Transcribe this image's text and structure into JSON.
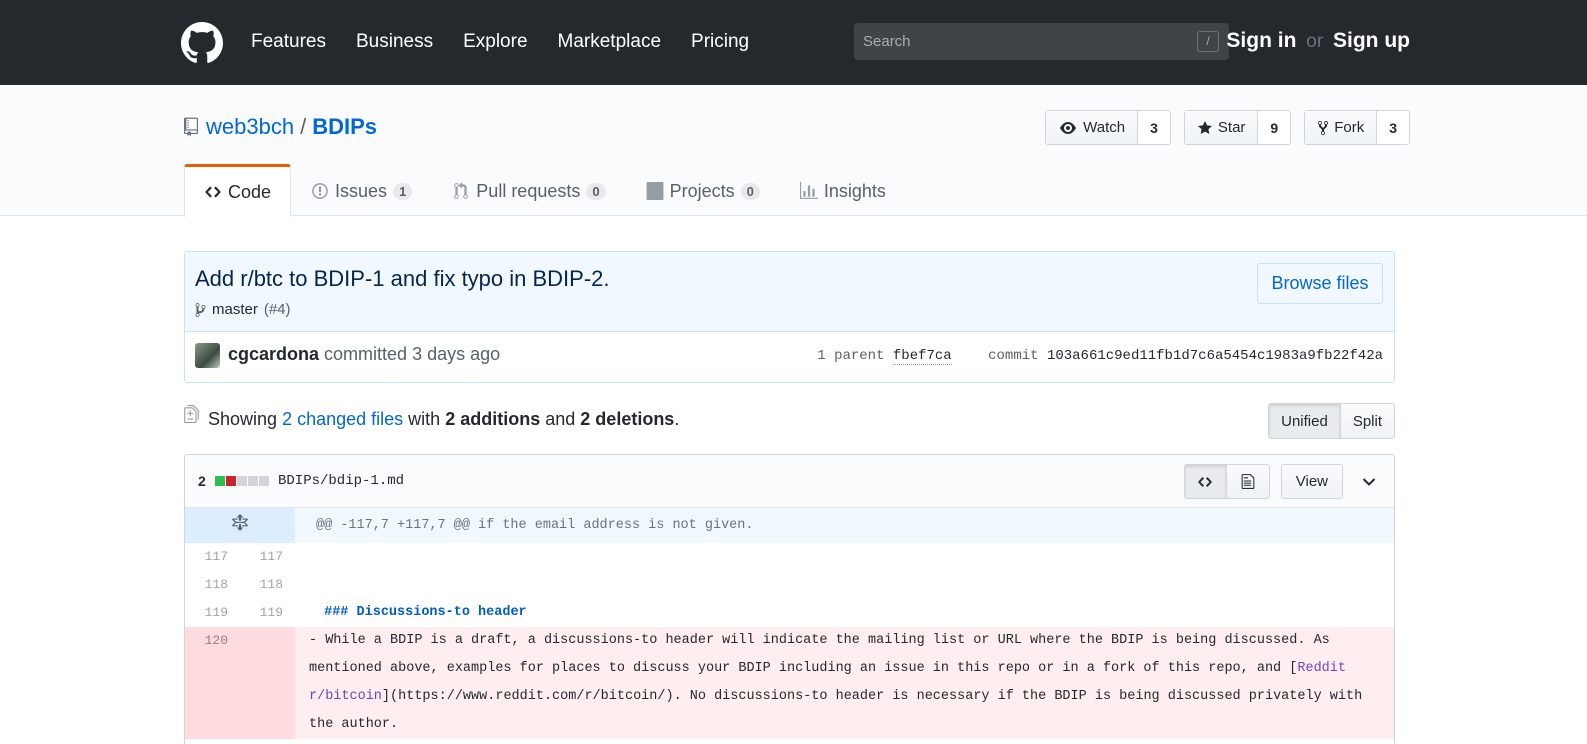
{
  "header": {
    "nav": [
      "Features",
      "Business",
      "Explore",
      "Marketplace",
      "Pricing"
    ],
    "search_placeholder": "Search",
    "search_shortcut": "/",
    "sign_in": "Sign in",
    "or": "or",
    "sign_up": "Sign up"
  },
  "repo": {
    "owner": "web3bch",
    "separator": "/",
    "name": "BDIPs",
    "watch_label": "Watch",
    "watch_count": "3",
    "star_label": "Star",
    "star_count": "9",
    "fork_label": "Fork",
    "fork_count": "3"
  },
  "tabs": {
    "code": "Code",
    "issues": "Issues",
    "issues_count": "1",
    "pulls": "Pull requests",
    "pulls_count": "0",
    "projects": "Projects",
    "projects_count": "0",
    "insights": "Insights"
  },
  "commit": {
    "title": "Add r/btc to BDIP-1 and fix typo in BDIP-2.",
    "branch": "master",
    "pr_ref": "(#4)",
    "browse_label": "Browse files",
    "author": "cgcardona",
    "action": "committed 3 days ago",
    "parent_label": "1 parent",
    "parent_sha": "fbef7ca",
    "commit_label": "commit",
    "sha": "103a661c9ed11fb1d7c6a5454c1983a9fb22f42a"
  },
  "toc": {
    "showing": "Showing",
    "changed_files": "2 changed files",
    "with": "with",
    "additions": "2 additions",
    "and": "and",
    "deletions": "2 deletions",
    "period": ".",
    "unified": "Unified",
    "split": "Split"
  },
  "file": {
    "change_count": "2",
    "path": "BDIPs/bdip-1.md",
    "view_label": "View",
    "diffstat_colors": [
      "#2cbe4e",
      "#cb2431",
      "#d1d5da",
      "#d1d5da",
      "#d1d5da"
    ]
  },
  "diff": {
    "hunk": "@@ -117,7 +117,7 @@ if the email address is not given.",
    "rows": [
      {
        "old": "117",
        "new": "117",
        "text": ""
      },
      {
        "old": "118",
        "new": "118",
        "text": ""
      },
      {
        "old": "119",
        "new": "119",
        "text": " ### Discussions-to header"
      }
    ],
    "del": {
      "old": "120",
      "prefix": "- While a BDIP is a draft, a discussions-to header will indicate the mailing list or URL where the BDIP is being discussed. As mentioned above, examples for places to discuss your BDIP including an issue in this repo or in a fork of this repo, and [",
      "link": "Reddit r/bitcoin",
      "suffix": "](https://www.reddit.com/r/bitcoin/). No discussions-to header is necessary if the BDIP is being discussed privately with the author."
    }
  }
}
